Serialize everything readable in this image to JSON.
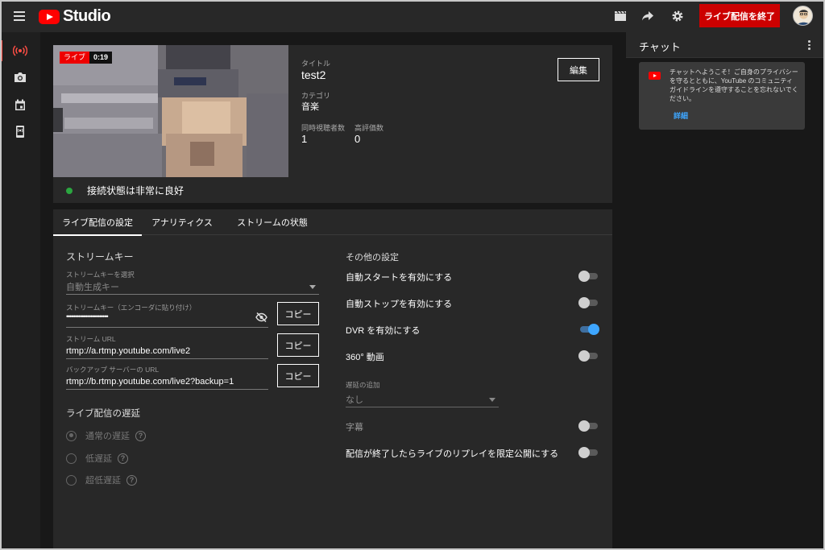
{
  "header": {
    "logo_text": "Studio",
    "end_stream_label": "ライブ配信を終了"
  },
  "stream": {
    "live_badge": "ライブ",
    "elapsed": "0:19",
    "title_label": "タイトル",
    "title_value": "test2",
    "category_label": "カテゴリ",
    "category_value": "音楽",
    "viewers_label": "同時視聴者数",
    "viewers_value": "1",
    "likes_label": "高評価数",
    "likes_value": "0",
    "edit_label": "編集",
    "connection_status": "接続状態は非常に良好",
    "status_color": "#2ba640"
  },
  "tabs": [
    {
      "label": "ライブ配信の設定",
      "active": true
    },
    {
      "label": "アナリティクス",
      "active": false
    },
    {
      "label": "ストリームの状態",
      "active": false
    }
  ],
  "stream_key": {
    "section_title": "ストリームキー",
    "select_label": "ストリームキーを選択",
    "select_value": "自動生成キー",
    "key_label": "ストリームキー（エンコーダに貼り付け）",
    "key_value": "••••••••••••••••••••••••",
    "copy_label": "コピー",
    "url_label": "ストリーム URL",
    "url_value": "rtmp://a.rtmp.youtube.com/live2",
    "backup_label": "バックアップ サーバーの URL",
    "backup_value": "rtmp://b.rtmp.youtube.com/live2?backup=1"
  },
  "latency": {
    "section_title": "ライブ配信の遅延",
    "options": [
      {
        "label": "通常の遅延",
        "selected": true
      },
      {
        "label": "低遅延",
        "selected": false
      },
      {
        "label": "超低遅延",
        "selected": false
      }
    ]
  },
  "other": {
    "section_title": "その他の設定",
    "auto_start": {
      "label": "自動スタートを有効にする",
      "on": false
    },
    "auto_stop": {
      "label": "自動ストップを有効にする",
      "on": false
    },
    "dvr": {
      "label": "DVR を有効にする",
      "on": true
    },
    "vr360": {
      "label": "360° 動画",
      "on": false
    },
    "delay_label": "遅延の追加",
    "delay_value": "なし",
    "captions": {
      "label": "字幕",
      "on": false
    },
    "unlisted_replay": {
      "label": "配信が終了したらライブのリプレイを限定公開にする",
      "on": false
    }
  },
  "chat": {
    "title": "チャット",
    "welcome_text": "チャットへようこそ！ご自身のプライバシーを守るとともに、YouTube のコミュニティ ガイドラインを遵守することを忘れないでください。",
    "details_link": "詳細"
  },
  "colors": {
    "brand_red": "#ff0000",
    "end_button": "#cc0000",
    "accent_blue": "#3ea6ff"
  }
}
